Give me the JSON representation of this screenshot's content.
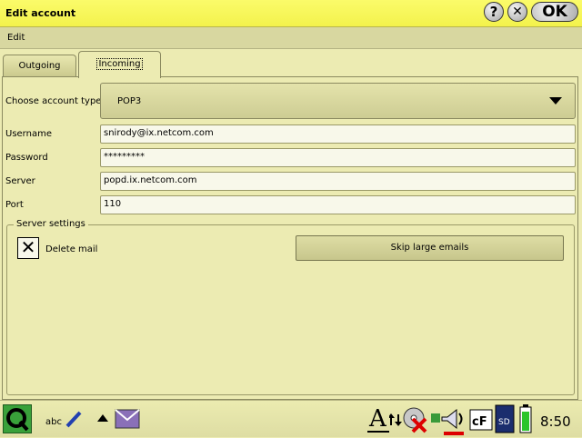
{
  "window": {
    "title": "Edit account",
    "help_label": "?",
    "close_label": "✕",
    "ok_label": "OK"
  },
  "menu": {
    "edit": "Edit"
  },
  "tabs": [
    {
      "label": "Outgoing"
    },
    {
      "label": "Incoming"
    }
  ],
  "form": {
    "account_type_label": "Choose account type",
    "account_type_value": "POP3",
    "username_label": "Username",
    "username_value": "snirody@ix.netcom.com",
    "password_label": "Password",
    "password_value": "*********",
    "server_label": "Server",
    "server_value": "popd.ix.netcom.com",
    "port_label": "Port",
    "port_value": "110"
  },
  "server_settings": {
    "title": "Server settings",
    "delete_mail_label": "Delete mail",
    "delete_mail_checked": true,
    "skip_button": "Skip large emails"
  },
  "taskbar": {
    "clock": "8:50",
    "input_method_label": "abc",
    "icons": [
      "q-launcher-icon",
      "handwriting-icon",
      "up-arrow-icon",
      "mail-icon",
      "font-a-icon",
      "network-icon",
      "cd-disabled-icon",
      "volume-icon",
      "cf-card-icon",
      "sd-card-icon",
      "battery-icon"
    ]
  },
  "colors": {
    "title_bar": "#f3f24c",
    "background": "#ecebb2"
  }
}
